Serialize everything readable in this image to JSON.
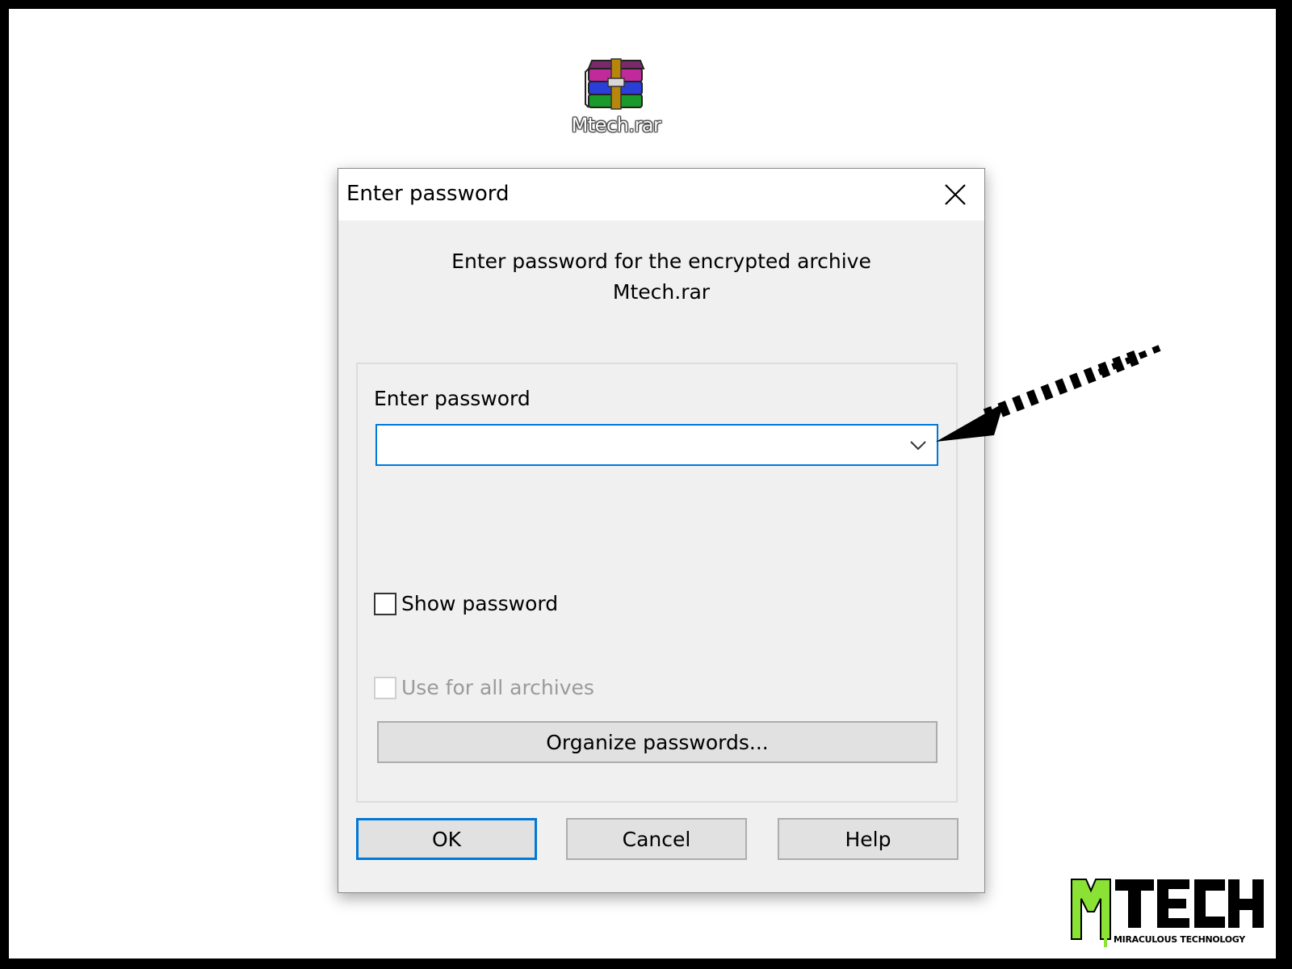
{
  "desktop": {
    "icon_name": "winrar-archive-icon",
    "file_label": "Mtech.rar"
  },
  "dialog": {
    "title": "Enter password",
    "close_icon": "close-icon",
    "prompt_line1": "Enter password for the encrypted archive",
    "prompt_line2": "Mtech.rar",
    "password_label": "Enter password",
    "password_value": "",
    "dropdown_icon": "chevron-down-icon",
    "show_password_label": "Show password",
    "show_password_checked": false,
    "use_for_all_label": "Use for all archives",
    "use_for_all_checked": false,
    "use_for_all_enabled": false,
    "organize_button": "Organize passwords...",
    "buttons": {
      "ok": "OK",
      "cancel": "Cancel",
      "help": "Help"
    }
  },
  "annotation": {
    "icon_name": "dashed-arrow-icon"
  },
  "logo": {
    "text": "MTECH",
    "tagline": "MIRACULOUS TECHNOLOGY",
    "colors": {
      "primary": "#000000",
      "accent": "#8ae234"
    }
  },
  "colors": {
    "focus_border": "#0078d7",
    "dialog_bg": "#f0f0f0"
  }
}
